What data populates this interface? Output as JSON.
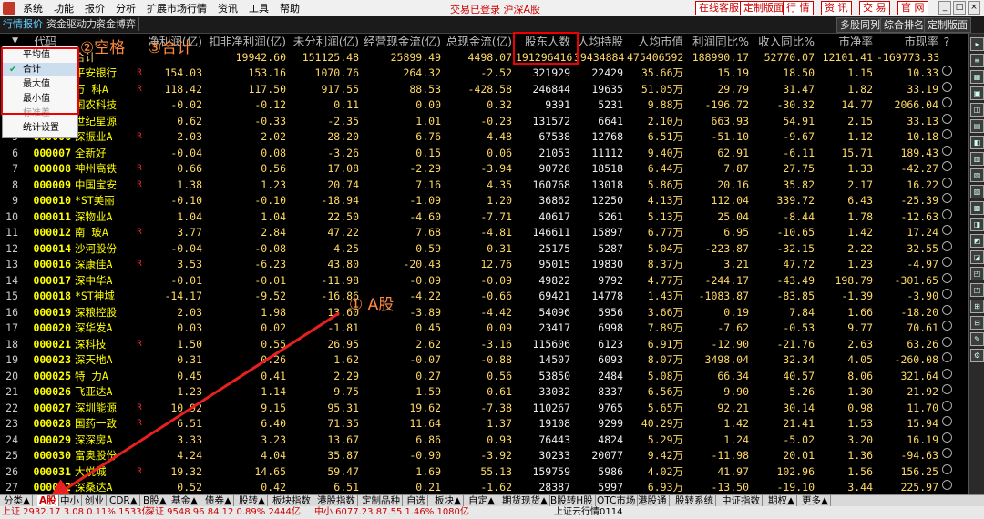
{
  "menubar": {
    "items": [
      "系统",
      "功能",
      "报价",
      "分析",
      "扩展市场行情",
      "资讯",
      "工具",
      "帮助"
    ],
    "status": "交易已登录  沪深A股",
    "right_buttons": [
      "在线客服",
      "定制版面",
      "行 情",
      "资 讯",
      "交 易",
      "官 网"
    ]
  },
  "tabbar": {
    "tabs": [
      "行情报价",
      "资金驱动力",
      "资金博弈"
    ],
    "right_tabs": [
      "多股同列",
      "综合排名",
      "定制版面"
    ]
  },
  "header": {
    "sort_arrow": "▼",
    "code": "代码",
    "cols": [
      "净利润(亿)",
      "扣非净利润(亿)",
      "未分利润(亿)",
      "经营现金流(亿)",
      "总现金流(亿)",
      "股东人数",
      "人均持股",
      "人均市值",
      "利润同比%",
      "收入同比%",
      "市净率",
      "市现率"
    ],
    "end": "?"
  },
  "total_row": {
    "name": "合计",
    "values": [
      "",
      "19942.60",
      "151125.48",
      "25899.49",
      "4498.07",
      "191296416",
      "39434884",
      "475406592",
      "188990.17",
      "52770.07",
      "12101.41",
      "-169773.33"
    ]
  },
  "rows": [
    {
      "i": "1",
      "code": "000001",
      "name": "平安银行",
      "r": "R",
      "v": [
        "154.03",
        "153.16",
        "1070.76",
        "264.32",
        "-2.52",
        "321929",
        "22429",
        "35.66万",
        "15.19",
        "18.50",
        "1.15",
        "10.33"
      ]
    },
    {
      "i": "2",
      "code": "000002",
      "name": "万 科A",
      "r": "R",
      "v": [
        "118.42",
        "117.50",
        "917.55",
        "88.53",
        "-428.58",
        "246844",
        "19635",
        "51.05万",
        "29.79",
        "31.47",
        "1.82",
        "33.19"
      ]
    },
    {
      "i": "3",
      "code": "000004",
      "name": "国农科技",
      "r": "",
      "v": [
        "-0.02",
        "-0.12",
        "0.11",
        "0.00",
        "0.32",
        "9391",
        "5231",
        "9.88万",
        "-196.72",
        "-30.32",
        "14.77",
        "2066.04"
      ]
    },
    {
      "i": "4",
      "code": "000005",
      "name": "世纪星源",
      "r": "",
      "v": [
        "0.62",
        "-0.33",
        "-2.35",
        "1.01",
        "-0.23",
        "131572",
        "6641",
        "2.10万",
        "663.93",
        "54.91",
        "2.15",
        "33.13"
      ]
    },
    {
      "i": "5",
      "code": "000006",
      "name": "深振业A",
      "r": "R",
      "v": [
        "2.03",
        "2.02",
        "28.20",
        "6.76",
        "4.48",
        "67538",
        "12768",
        "6.51万",
        "-51.10",
        "-9.67",
        "1.12",
        "10.18"
      ]
    },
    {
      "i": "6",
      "code": "000007",
      "name": "全新好",
      "r": "",
      "v": [
        "-0.04",
        "0.08",
        "-3.26",
        "0.15",
        "0.06",
        "21053",
        "11112",
        "9.40万",
        "62.91",
        "-6.11",
        "15.71",
        "189.43"
      ]
    },
    {
      "i": "7",
      "code": "000008",
      "name": "神州高铁",
      "r": "R",
      "v": [
        "0.66",
        "0.56",
        "17.08",
        "-2.29",
        "-3.94",
        "90728",
        "18518",
        "6.44万",
        "7.87",
        "27.75",
        "1.33",
        "-42.27"
      ]
    },
    {
      "i": "8",
      "code": "000009",
      "name": "中国宝安",
      "r": "R",
      "v": [
        "1.38",
        "1.23",
        "20.74",
        "7.16",
        "4.35",
        "160768",
        "13018",
        "5.86万",
        "20.16",
        "35.82",
        "2.17",
        "16.22"
      ]
    },
    {
      "i": "9",
      "code": "000010",
      "name": "*ST美丽",
      "r": "",
      "v": [
        "-0.10",
        "-0.10",
        "-18.94",
        "-1.09",
        "1.20",
        "36862",
        "12250",
        "4.13万",
        "112.04",
        "339.72",
        "6.43",
        "-25.39"
      ]
    },
    {
      "i": "10",
      "code": "000011",
      "name": "深物业A",
      "r": "",
      "v": [
        "1.04",
        "1.04",
        "22.50",
        "-4.60",
        "-7.71",
        "40617",
        "5261",
        "5.13万",
        "25.04",
        "-8.44",
        "1.78",
        "-12.63"
      ]
    },
    {
      "i": "11",
      "code": "000012",
      "name": "南 玻A",
      "r": "R",
      "v": [
        "3.77",
        "2.84",
        "47.22",
        "7.68",
        "-4.81",
        "146611",
        "15897",
        "6.77万",
        "6.95",
        "-10.65",
        "1.42",
        "17.24"
      ]
    },
    {
      "i": "12",
      "code": "000014",
      "name": "沙河股份",
      "r": "",
      "v": [
        "-0.04",
        "-0.08",
        "4.25",
        "0.59",
        "0.31",
        "25175",
        "5287",
        "5.04万",
        "-223.87",
        "-32.15",
        "2.22",
        "32.55"
      ]
    },
    {
      "i": "13",
      "code": "000016",
      "name": "深康佳A",
      "r": "R",
      "v": [
        "3.53",
        "-6.23",
        "43.80",
        "-20.43",
        "12.76",
        "95015",
        "19830",
        "8.37万",
        "3.21",
        "47.72",
        "1.23",
        "-4.97"
      ]
    },
    {
      "i": "14",
      "code": "000017",
      "name": "深中华A",
      "r": "",
      "v": [
        "-0.01",
        "-0.01",
        "-11.98",
        "-0.09",
        "-0.09",
        "49822",
        "9792",
        "4.77万",
        "-244.17",
        "-43.49",
        "198.79",
        "-301.65"
      ]
    },
    {
      "i": "15",
      "code": "000018",
      "name": "*ST神城",
      "r": "",
      "v": [
        "-14.17",
        "-9.52",
        "-16.86",
        "-4.22",
        "-0.66",
        "69421",
        "14778",
        "1.43万",
        "-1083.87",
        "-83.85",
        "-1.39",
        "-3.90"
      ]
    },
    {
      "i": "16",
      "code": "000019",
      "name": "深粮控股",
      "r": "",
      "v": [
        "2.03",
        "1.98",
        "13.60",
        "-3.89",
        "-4.42",
        "54096",
        "5956",
        "3.66万",
        "0.19",
        "7.84",
        "1.66",
        "-18.20"
      ]
    },
    {
      "i": "17",
      "code": "000020",
      "name": "深华发A",
      "r": "",
      "v": [
        "0.03",
        "0.02",
        "-1.81",
        "0.45",
        "0.09",
        "23417",
        "6998",
        "7.89万",
        "-7.62",
        "-0.53",
        "9.77",
        "70.61"
      ]
    },
    {
      "i": "18",
      "code": "000021",
      "name": "深科技",
      "r": "R",
      "v": [
        "1.50",
        "0.55",
        "26.95",
        "2.62",
        "-3.16",
        "115606",
        "6123",
        "6.91万",
        "-12.90",
        "-21.76",
        "2.63",
        "63.26"
      ]
    },
    {
      "i": "19",
      "code": "000023",
      "name": "深天地A",
      "r": "",
      "v": [
        "0.31",
        "0.26",
        "1.62",
        "-0.07",
        "-0.88",
        "14507",
        "6093",
        "8.07万",
        "3498.04",
        "32.34",
        "4.05",
        "-260.08"
      ]
    },
    {
      "i": "20",
      "code": "000025",
      "name": "特 力A",
      "r": "",
      "v": [
        "0.45",
        "0.41",
        "2.29",
        "0.27",
        "0.56",
        "53850",
        "2484",
        "5.08万",
        "66.34",
        "40.57",
        "8.06",
        "321.64"
      ]
    },
    {
      "i": "21",
      "code": "000026",
      "name": "飞亚达A",
      "r": "",
      "v": [
        "1.23",
        "1.14",
        "9.75",
        "1.59",
        "0.61",
        "33032",
        "8337",
        "6.56万",
        "9.90",
        "5.26",
        "1.30",
        "21.92"
      ]
    },
    {
      "i": "22",
      "code": "000027",
      "name": "深圳能源",
      "r": "R",
      "v": [
        "10.92",
        "9.15",
        "95.31",
        "19.62",
        "-7.38",
        "110267",
        "9765",
        "5.65万",
        "92.21",
        "30.14",
        "0.98",
        "11.70"
      ]
    },
    {
      "i": "23",
      "code": "000028",
      "name": "国药一致",
      "r": "R",
      "v": [
        "6.51",
        "6.40",
        "71.35",
        "11.64",
        "1.37",
        "19108",
        "9299",
        "40.29万",
        "1.42",
        "21.41",
        "1.53",
        "15.94"
      ]
    },
    {
      "i": "24",
      "code": "000029",
      "name": "深深房A",
      "r": "",
      "v": [
        "3.33",
        "3.23",
        "13.67",
        "6.86",
        "0.93",
        "76443",
        "4824",
        "5.29万",
        "1.24",
        "-5.02",
        "3.20",
        "16.19"
      ]
    },
    {
      "i": "25",
      "code": "000030",
      "name": "富奥股份",
      "r": "",
      "v": [
        "4.24",
        "4.04",
        "35.87",
        "-0.90",
        "-3.92",
        "30233",
        "20077",
        "9.42万",
        "-11.98",
        "20.01",
        "1.36",
        "-94.63"
      ]
    },
    {
      "i": "26",
      "code": "000031",
      "name": "大悦城",
      "r": "R",
      "v": [
        "19.32",
        "14.65",
        "59.47",
        "1.69",
        "55.13",
        "159759",
        "5986",
        "4.02万",
        "41.97",
        "102.96",
        "1.56",
        "156.25"
      ]
    },
    {
      "i": "27",
      "code": "000032",
      "name": "深桑达A",
      "r": "",
      "v": [
        "0.52",
        "0.42",
        "6.51",
        "0.21",
        "-1.62",
        "28387",
        "5997",
        "6.93万",
        "-13.50",
        "-19.10",
        "3.44",
        "225.97"
      ]
    }
  ],
  "popup": {
    "items": [
      "平均值",
      "合计",
      "最大值",
      "最小值",
      "标准差",
      "统计设置"
    ],
    "checked": "✔"
  },
  "annotations": {
    "space": "②空格",
    "sum": "③合计",
    "astock": "① A股"
  },
  "bottom_tabs": [
    "分类▲",
    "A股",
    "中小",
    "创业",
    "CDR▲",
    "B股▲",
    "基金▲",
    "债券▲",
    "股转▲",
    "板块指数",
    "港股指数",
    "定制品种",
    "自选",
    "板块▲",
    "自定▲",
    "期货现货▲",
    "B股转H股",
    "OTC市场",
    "港股通",
    "股转系统",
    "中证指数",
    "期权▲",
    "更多▲"
  ],
  "statusbar": {
    "sh": "上证 2932.17   3.08  0.11%  1533亿",
    "sz": "深证 9548.96  84.12  0.89%  2444亿",
    "zx": "中小 6077.23  87.55  1.46%  1080亿",
    "info": "上证云行情0114"
  },
  "colors": {
    "positive": "#ffd966",
    "red": "#f33",
    "accent": "#6cf",
    "highlight": "#e00"
  }
}
